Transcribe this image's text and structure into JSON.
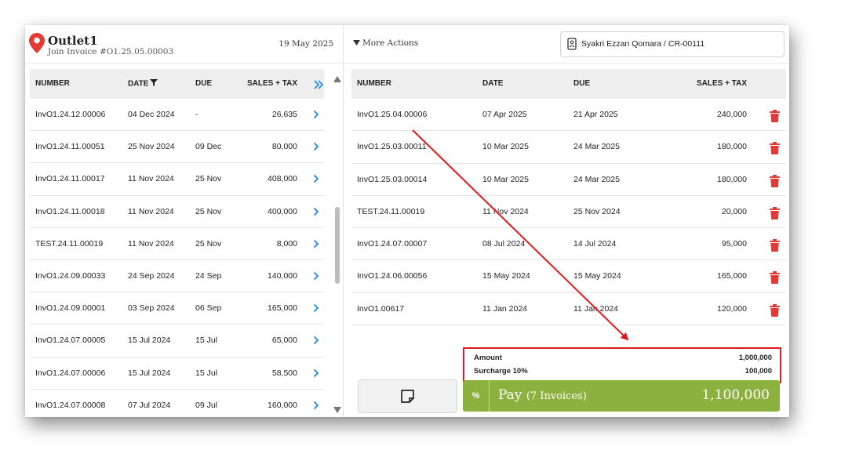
{
  "left": {
    "outlet_name": "Outlet1",
    "join_invoice": "Join Invoice #O1.25.05.00003",
    "date": "19 May 2025",
    "columns": {
      "number": "NUMBER",
      "date": "DATE",
      "due": "DUE",
      "sales_tax": "SALES + TAX"
    },
    "rows": [
      {
        "number": "InvO1.24.12.00006",
        "date": "04 Dec 2024",
        "due": "-",
        "amount": "26,635"
      },
      {
        "number": "InvO1.24.11.00051",
        "date": "25 Nov 2024",
        "due": "09 Dec",
        "amount": "80,000"
      },
      {
        "number": "InvO1.24.11.00017",
        "date": "11 Nov 2024",
        "due": "25 Nov",
        "amount": "408,000"
      },
      {
        "number": "InvO1.24.11.00018",
        "date": "11 Nov 2024",
        "due": "25 Nov",
        "amount": "400,000"
      },
      {
        "number": "TEST.24.11.00019",
        "date": "11 Nov 2024",
        "due": "25 Nov",
        "amount": "8,000"
      },
      {
        "number": "InvO1.24.09.00033",
        "date": "24 Sep 2024",
        "due": "24 Sep",
        "amount": "140,000"
      },
      {
        "number": "InvO1.24.09.00001",
        "date": "03 Sep 2024",
        "due": "06 Sep",
        "amount": "165,000"
      },
      {
        "number": "InvO1.24.07.00005",
        "date": "15 Jul 2024",
        "due": "15 Jul",
        "amount": "65,000"
      },
      {
        "number": "InvO1.24.07.00006",
        "date": "15 Jul 2024",
        "due": "15 Jul",
        "amount": "58,500"
      },
      {
        "number": "InvO1.24.07.00008",
        "date": "07 Jul 2024",
        "due": "09 Jul",
        "amount": "160,000"
      }
    ]
  },
  "right": {
    "more_actions": "More Actions",
    "customer": "Syakri Ezzan Qomara / CR-00111",
    "columns": {
      "number": "NUMBER",
      "date": "DATE",
      "due": "DUE",
      "sales_tax": "SALES + TAX"
    },
    "rows": [
      {
        "number": "InvO1.25.04.00006",
        "date": "07 Apr 2025",
        "due": "21 Apr 2025",
        "amount": "240,000"
      },
      {
        "number": "InvO1.25.03.00011",
        "date": "10 Mar 2025",
        "due": "24 Mar 2025",
        "amount": "180,000"
      },
      {
        "number": "InvO1.25.03.00014",
        "date": "10 Mar 2025",
        "due": "24 Mar 2025",
        "amount": "180,000"
      },
      {
        "number": "TEST.24.11.00019",
        "date": "11 Nov 2024",
        "due": "25 Nov 2024",
        "amount": "20,000"
      },
      {
        "number": "InvO1.24.07.00007",
        "date": "08 Jul 2024",
        "due": "14 Jul 2024",
        "amount": "95,000"
      },
      {
        "number": "InvO1.24.06.00056",
        "date": "15 May 2024",
        "due": "15 May 2024",
        "amount": "165,000"
      },
      {
        "number": "InvO1.00617",
        "date": "11 Jan 2024",
        "due": "11 Jan 2024",
        "amount": "120,000"
      }
    ],
    "summary": {
      "amount_label": "Amount",
      "amount_value": "1,000,000",
      "surcharge_label": "Surcharge 10%",
      "surcharge_value": "100,000"
    },
    "pay": {
      "percent_symbol": "%",
      "label": "Pay",
      "count": "(7 Invoices)",
      "total": "1,100,000"
    }
  },
  "colors": {
    "pin": "#e53935",
    "link_chevron": "#1e88e5",
    "trash": "#e53935",
    "pay_button": "#8db13f",
    "highlight": "#e0191d"
  }
}
